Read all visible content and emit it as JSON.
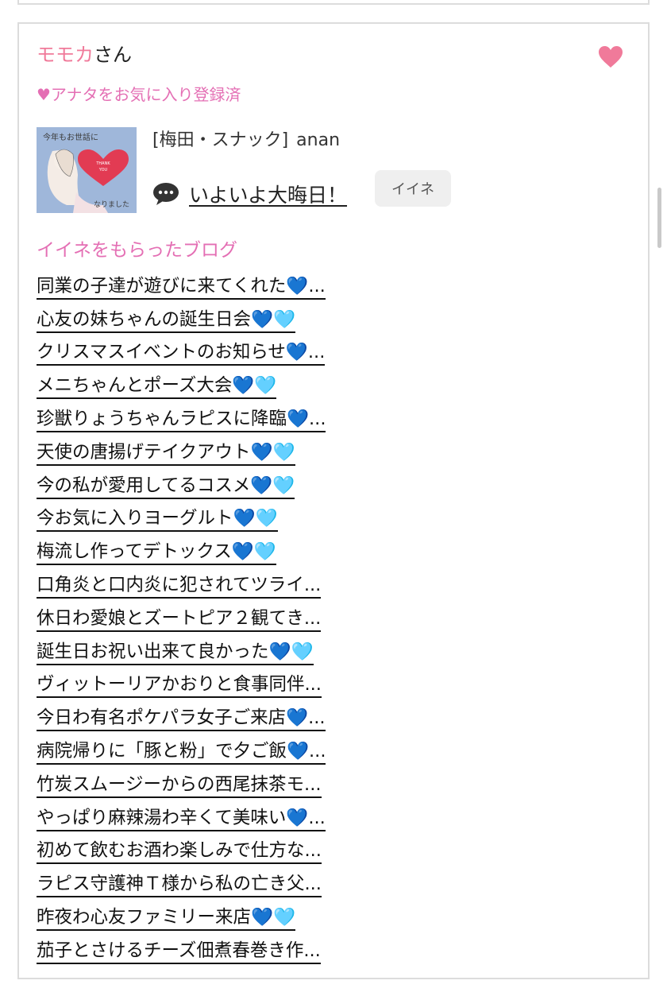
{
  "card": {
    "name_highlight": "モモカ",
    "name_suffix": "さん",
    "fav_status": "♥アナタをお気に入り登録済",
    "shop_area": "[梅田・スナック]",
    "shop_name": "anan",
    "latest_blog_title": "いよいよ大晦日！",
    "iine_label": "イイネ",
    "thumbnail_text": [
      "今年もお世話に",
      "THANK YOU",
      "なりました"
    ],
    "section_title": "イイネをもらったブログ",
    "blogs": [
      "同業の子達が遊びに来てくれた💙...",
      "心友の妹ちゃんの誕生日会💙🩵",
      "クリスマスイベントのお知らせ💙...",
      "メニちゃんとポーズ大会💙🩵",
      "珍獣りょうちゃんラピスに降臨💙...",
      "天使の唐揚げテイクアウト💙🩵",
      "今の私が愛用してるコスメ💙🩵",
      "今お気に入りヨーグルト💙🩵",
      "梅流し作ってデトックス💙🩵",
      "口角炎と口内炎に犯されてツライ...",
      "休日わ愛娘とズートピア２観てき...",
      "誕生日お祝い出来て良かった💙🩵",
      "ヴィットーリアかおりと食事同伴...",
      "今日わ有名ポケパラ女子ご来店💙...",
      "病院帰りに「豚と粉」で夕ご飯💙...",
      "竹炭スムージーからの西尾抹茶モ...",
      "やっぱり麻辣湯わ辛くて美味い💙...",
      "初めて飲むお酒わ楽しみで仕方な...",
      "ラピス守護神Ｔ様から私の亡き父...",
      "昨夜わ心友ファミリー来店💙🩵",
      "茄子とさけるチーズ佃煮春巻き作..."
    ]
  },
  "colors": {
    "accent_pink": "#f07a9a",
    "fav_pink": "#e46fb4",
    "border": "#dcdcdc"
  },
  "icons": {
    "favorite": "heart-icon",
    "comment": "speech-bubble-icon"
  }
}
